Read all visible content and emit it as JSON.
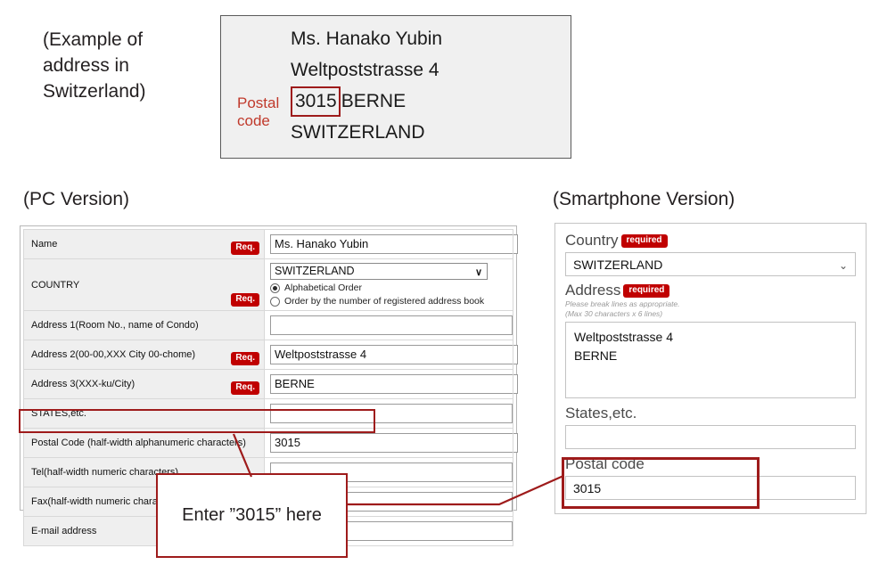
{
  "example": {
    "caption": "(Example of address in Switzerland)",
    "envelope": {
      "line1": "Ms. Hanako Yubin",
      "line2": "Weltpoststrasse 4",
      "zip": "3015",
      "city": "BERNE",
      "country": "SWITZERLAND",
      "postal_label_line1": "Postal",
      "postal_label_line2": "code"
    }
  },
  "pc": {
    "heading": "(PC Version)",
    "rows": [
      {
        "label": "Name",
        "required": "Req.",
        "value": "Ms. Hanako Yubin"
      },
      {
        "label": "COUNTRY",
        "required": "Req.",
        "value": "SWITZERLAND"
      },
      {
        "label": "Address 1(Room No., name of Condo)",
        "required": "",
        "value": ""
      },
      {
        "label": "Address 2(00-00,XXX City 00-chome)",
        "required": "Req.",
        "value": "Weltpoststrasse 4"
      },
      {
        "label": "Address 3(XXX-ku/City)",
        "required": "Req.",
        "value": "BERNE"
      },
      {
        "label": "STATES,etc.",
        "required": "",
        "value": ""
      },
      {
        "label": "Postal Code (half-width alphanumeric characters)",
        "required": "",
        "value": "3015"
      },
      {
        "label": "Tel(half-width numeric characters)",
        "required": "",
        "value": ""
      },
      {
        "label": "Fax(half-width numeric characters)",
        "required": "",
        "value": ""
      },
      {
        "label": "E-mail address",
        "required": "",
        "value": ""
      }
    ],
    "country_radio_1": "Alphabetical Order",
    "country_radio_2": "Order by the number of registered address book",
    "chevron": "∨"
  },
  "sp": {
    "heading": "(Smartphone Version)",
    "country_label": "Country",
    "country_required": "required",
    "country_value": "SWITZERLAND",
    "address_label": "Address",
    "address_required": "required",
    "address_note_1": "Please break lines as appropriate.",
    "address_note_2": "(Max 30 characters x 6 lines)",
    "address_value": "Weltpoststrasse 4\nBERNE",
    "states_label": "States,etc.",
    "states_value": "",
    "postal_label": "Postal code",
    "postal_value": "3015",
    "chevron": "⌄"
  },
  "callout": {
    "text": "Enter ”3015” here"
  },
  "colors": {
    "highlight_red": "#9e1b1b",
    "required_red": "#c00000",
    "postal_label_red": "#c0392b",
    "envelope_bg": "#f0f0f0"
  }
}
